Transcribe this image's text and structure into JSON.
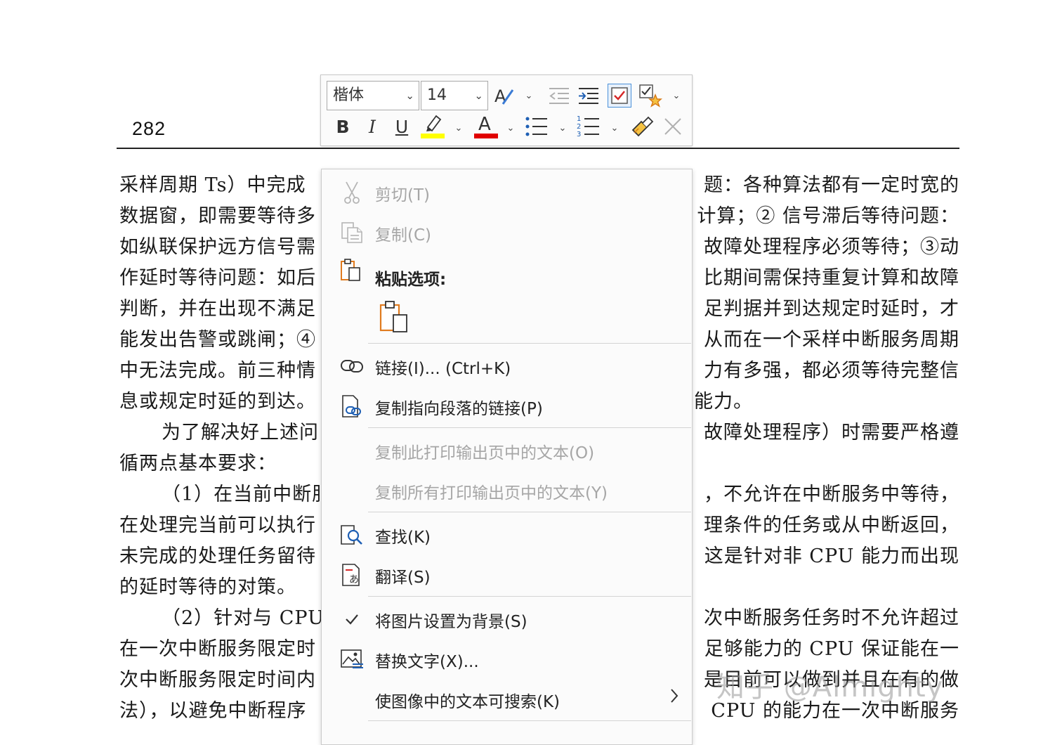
{
  "document": {
    "page_number": "282",
    "lines": [
      "采样周期 Ts）中完成",
      "数据窗，即需要等待多",
      "如纵联保护远方信号需",
      "作延时等待问题：如后",
      "判断，并在出现不满足",
      "能发出告警或跳闸；④",
      "中无法完成。前三种情",
      "息或规定时延的到达。",
      "为了解决好上述问",
      "循两点基本要求：",
      "（1）在当前中断服",
      "在处理完当前可以执行",
      "未完成的处理任务留待",
      "的延时等待的对策。",
      "（2）针对与 CPU",
      "在一次中断服务限定时",
      "次中断服务限定时间内",
      "法），以避免中断程序"
    ],
    "lines_right": [
      "题：各种算法都有一定时宽的",
      "计算；② 信号滞后等待问题：",
      "故障处理程序必须等待；③动",
      "比期间需保持重复计算和故障",
      "足判据并到达规定时延时，才",
      "从而在一个采样中断服务周期",
      "力有多强，都必须等待完整信",
      "能力。",
      "故障处理程序）时需要严格遵",
      "",
      "，不允许在中断服务中等待，",
      "理条件的任务或从中断返回，",
      "这是针对非 CPU 能力而出现",
      "",
      "次中断服务任务时不允许超过",
      "足够能力的 CPU 保证能在一",
      "是目前可以做到并且在有的做",
      "CPU 的能力在一次中断服务"
    ],
    "watermark": "知乎 @Almighty"
  },
  "toolbar": {
    "font_name": "楷体",
    "font_size": "14",
    "highlight_color": "#ffff00",
    "font_color": "#e00000",
    "icons": [
      "text-style-icon",
      "decrease-indent-icon",
      "increase-indent-icon",
      "track-changes-icon",
      "styles-icon",
      "bold-icon",
      "italic-icon",
      "underline-icon",
      "highlight-icon",
      "font-color-icon",
      "bullets-icon",
      "numbering-icon",
      "format-painter-icon",
      "close-icon"
    ]
  },
  "menu": {
    "cut": "剪切(T)",
    "copy": "复制(C)",
    "paste_options": "粘贴选项:",
    "link": "链接(I)...  (Ctrl+K)",
    "copy_paragraph_link": "复制指向段落的链接(P)",
    "copy_page_text": "复制此打印输出页中的文本(O)",
    "copy_all_pages_text": "复制所有打印输出页中的文本(Y)",
    "find": "查找(K)",
    "translate": "翻译(S)",
    "set_background": "将图片设置为背景(S)",
    "alt_text": "替换文字(X)...",
    "searchable_text": "使图像中的文本可搜索(K)",
    "accent_color": "#e07b1f",
    "link_icon_color": "#1e5fb4"
  }
}
